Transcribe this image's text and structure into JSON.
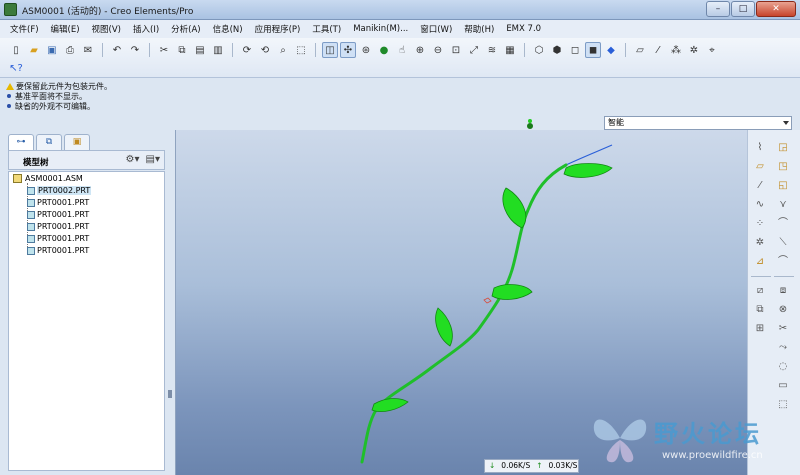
{
  "window": {
    "title": "ASM0001 (活动的) - Creo Elements/Pro",
    "minimize": "–",
    "maximize": "□",
    "close": "✕"
  },
  "menu": [
    "文件(F)",
    "编辑(E)",
    "视图(V)",
    "插入(I)",
    "分析(A)",
    "信息(N)",
    "应用程序(P)",
    "工具(T)",
    "Manikin(M)...",
    "窗口(W)",
    "帮助(H)",
    "EMX 7.0"
  ],
  "messages": {
    "line1": "要保留此元件为包装元件。",
    "line2": "基准平面将不显示。",
    "line3": "缺省的外观不可编辑。"
  },
  "filter": {
    "selected": "智能"
  },
  "model_tree": {
    "title": "模型树",
    "root": "ASM0001.ASM",
    "items": [
      {
        "label": "PRT0002.PRT",
        "selected": true
      },
      {
        "label": "PRT0001.PRT",
        "selected": false
      },
      {
        "label": "PRT0001.PRT",
        "selected": false
      },
      {
        "label": "PRT0001.PRT",
        "selected": false
      },
      {
        "label": "PRT0001.PRT",
        "selected": false
      },
      {
        "label": "PRT0001.PRT",
        "selected": false
      }
    ]
  },
  "status": {
    "download": "0.06K/S",
    "upload": "0.03K/S"
  },
  "watermark": {
    "text": "野火论坛",
    "url": "www.proewildfire.cn"
  },
  "colors": {
    "leaf_green": "#22dd22",
    "stem_green": "#1fbf2a",
    "curve_blue": "#2a5fd8",
    "viewport_top": "#cdd9ea",
    "viewport_bottom": "#6a84ad"
  }
}
